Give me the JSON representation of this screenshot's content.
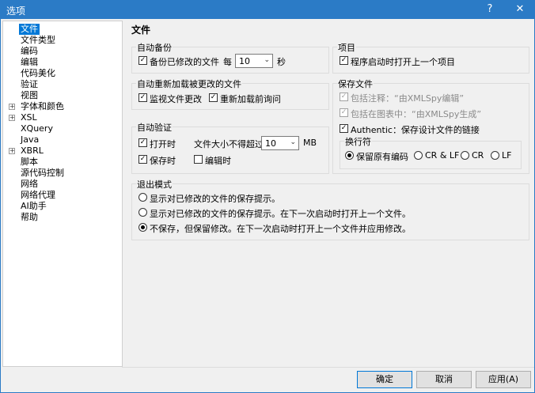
{
  "window": {
    "title": "选项",
    "help_button": "?",
    "close_button": "✕"
  },
  "tree": {
    "items": [
      {
        "label": "文件",
        "expandable": false,
        "selected": true
      },
      {
        "label": "文件类型",
        "expandable": false
      },
      {
        "label": "编码",
        "expandable": false
      },
      {
        "label": "编辑",
        "expandable": false
      },
      {
        "label": "代码美化",
        "expandable": false
      },
      {
        "label": "验证",
        "expandable": false
      },
      {
        "label": "视图",
        "expandable": false
      },
      {
        "label": "字体和颜色",
        "expandable": true
      },
      {
        "label": "XSL",
        "expandable": true
      },
      {
        "label": "XQuery",
        "expandable": false
      },
      {
        "label": "Java",
        "expandable": false
      },
      {
        "label": "XBRL",
        "expandable": true
      },
      {
        "label": "脚本",
        "expandable": false
      },
      {
        "label": "源代码控制",
        "expandable": false
      },
      {
        "label": "网络",
        "expandable": false
      },
      {
        "label": "网络代理",
        "expandable": false
      },
      {
        "label": "AI助手",
        "expandable": false
      },
      {
        "label": "帮助",
        "expandable": false
      }
    ],
    "expander_symbol": "+"
  },
  "panel": {
    "title": "文件",
    "autosave": {
      "title": "自动备份",
      "backup_label": "备份已修改的文件",
      "every_label": "每",
      "interval_value": "10",
      "unit_label": "秒",
      "checked": true
    },
    "reload": {
      "title": "自动重新加载被更改的文件",
      "watch_label": "监视文件更改",
      "ask_label": "重新加载前询问",
      "watch_checked": true,
      "ask_checked": true
    },
    "autovalidate": {
      "title": "自动验证",
      "open_label": "打开时",
      "save_label": "保存时",
      "edit_label": "编辑时",
      "size_label": "文件大小不得超过",
      "size_value": "10",
      "size_unit": "MB",
      "open_checked": true,
      "save_checked": true,
      "edit_checked": false
    },
    "project": {
      "title": "项目",
      "reopen_label": "程序启动时打开上一个项目",
      "checked": true
    },
    "save_file": {
      "title": "保存文件",
      "comment_label": "包括注释：“由XMLSpy编辑”",
      "graph_label": "包括在图表中：“由XMLSpy生成”",
      "authentic_label": "Authentic：保存设计文件的链接",
      "authentic_checked": true
    },
    "line_break": {
      "title": "换行符",
      "options": [
        "保留原有编码",
        "CR & LF",
        "CR",
        "LF"
      ],
      "selected": "保留原有编码"
    },
    "exit_mode": {
      "title": "退出模式",
      "options": [
        "显示对已修改的文件的保存提示。",
        "显示对已修改的文件的保存提示。在下一次启动时打开上一个文件。",
        "不保存，但保留修改。在下一次启动时打开上一个文件并应用修改。"
      ],
      "selected_index": 2
    }
  },
  "footer": {
    "ok": "确定",
    "cancel": "取消",
    "apply": "应用(A)"
  },
  "icons": {
    "check": "✓",
    "dropdown": "⌄",
    "help": "?",
    "close": "✕"
  }
}
